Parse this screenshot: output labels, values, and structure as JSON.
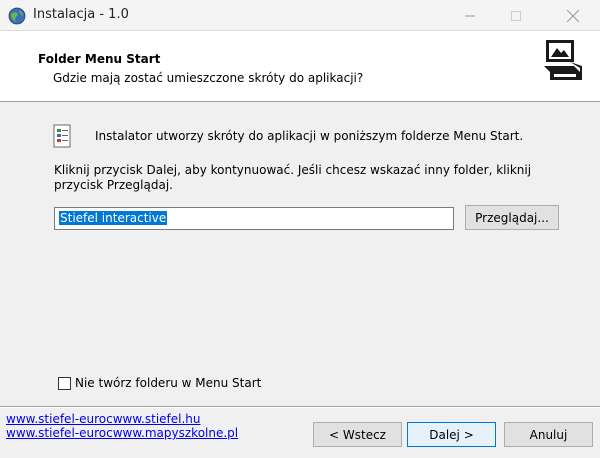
{
  "window": {
    "title": "Instalacja - 1.0"
  },
  "header": {
    "title": "Folder Menu Start",
    "subtitle": "Gdzie mają zostać umieszczone skróty do aplikacji?"
  },
  "body": {
    "intro": "Instalator utworzy skróty do aplikacji w poniższym folderze Menu Start.",
    "instructions": "Kliknij przycisk Dalej, aby kontynuować. Jeśli chcesz wskazać inny folder, kliknij przycisk Przeglądaj.",
    "folder_value": "Stiefel interactive",
    "browse_label": "Przeglądaj...",
    "no_folder_label": "Nie twórz folderu w Menu Start",
    "no_folder_checked": false
  },
  "footer": {
    "link1": "www.stiefel-eurocwww.stiefel.hu",
    "link2": "www.stiefel-eurocwww.mapyszkolne.pl",
    "back_label": "< Wstecz",
    "next_label": "Dalej >",
    "cancel_label": "Anuluj"
  },
  "icons": {
    "app": "globe-icon",
    "wizard": "computer-box-icon",
    "folder": "start-menu-folder-icon",
    "minimize": "minimize-icon",
    "maximize": "maximize-icon",
    "close": "close-icon"
  },
  "colors": {
    "selection": "#0078d7",
    "link": "#0000ee",
    "default_button_border": "#0078d7"
  }
}
